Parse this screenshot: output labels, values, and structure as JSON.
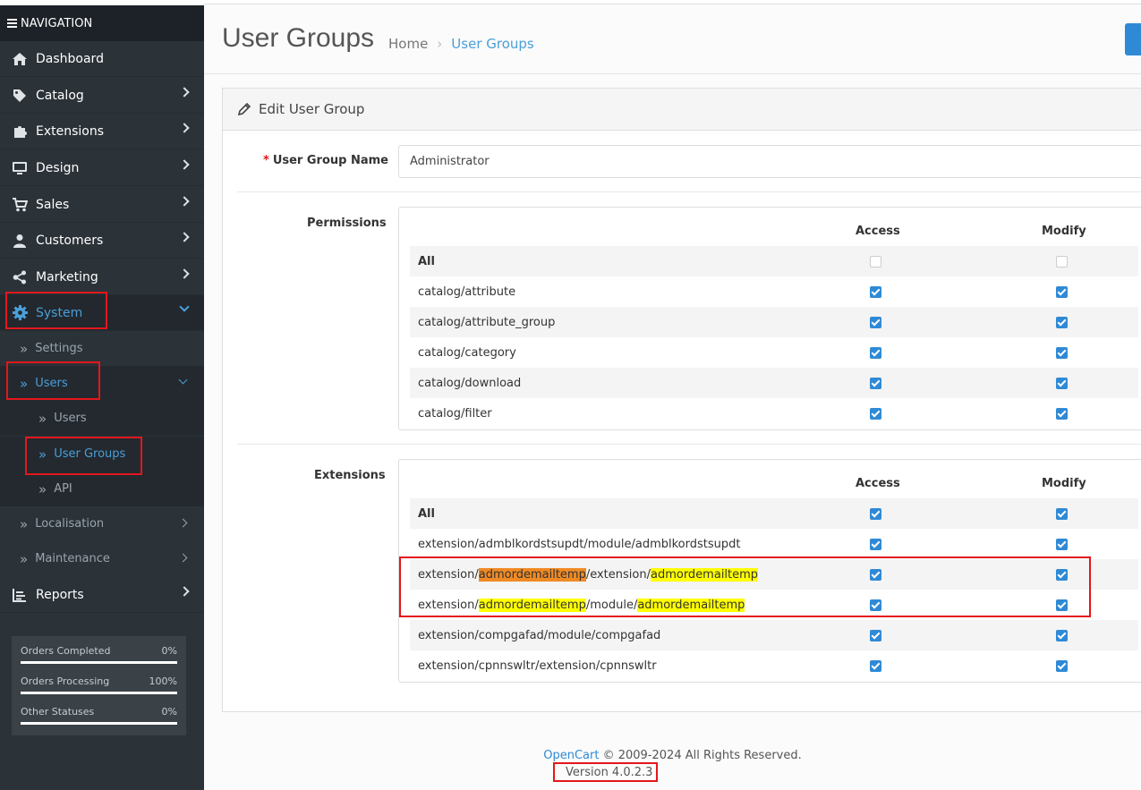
{
  "sidebar": {
    "header": "NAVIGATION",
    "items": [
      {
        "label": "Dashboard",
        "icon": "home-icon"
      },
      {
        "label": "Catalog",
        "icon": "tag-icon"
      },
      {
        "label": "Extensions",
        "icon": "puzzle-icon"
      },
      {
        "label": "Design",
        "icon": "monitor-icon"
      },
      {
        "label": "Sales",
        "icon": "cart-icon"
      },
      {
        "label": "Customers",
        "icon": "user-icon"
      },
      {
        "label": "Marketing",
        "icon": "share-icon"
      },
      {
        "label": "System",
        "icon": "gear-icon"
      },
      {
        "label": "Reports",
        "icon": "chart-icon"
      }
    ],
    "system_sub": {
      "settings": "Settings",
      "users": "Users",
      "users_sub": [
        "Users",
        "User Groups",
        "API"
      ],
      "localisation": "Localisation",
      "maintenance": "Maintenance"
    },
    "stats": [
      {
        "label": "Orders Completed",
        "pct": "0%",
        "value": 0
      },
      {
        "label": "Orders Processing",
        "pct": "100%",
        "value": 1
      },
      {
        "label": "Other Statuses",
        "pct": "0%",
        "value": 0
      }
    ]
  },
  "header": {
    "title": "User Groups",
    "breadcrumb": [
      "Home",
      "User Groups"
    ]
  },
  "card": {
    "title": "Edit User Group",
    "name_label": "User Group Name",
    "name_required_mark": "*",
    "name_value": "Administrator",
    "permissions_label": "Permissions",
    "extensions_label": "Extensions",
    "col_access": "Access",
    "col_modify": "Modify",
    "permissions": [
      {
        "label": "All",
        "access": false,
        "modify": false
      },
      {
        "label": "catalog/attribute",
        "access": true,
        "modify": true
      },
      {
        "label": "catalog/attribute_group",
        "access": true,
        "modify": true
      },
      {
        "label": "catalog/category",
        "access": true,
        "modify": true
      },
      {
        "label": "catalog/download",
        "access": true,
        "modify": true
      },
      {
        "label": "catalog/filter",
        "access": true,
        "modify": true
      }
    ],
    "extensions": [
      {
        "label": "All",
        "access": true,
        "modify": true
      },
      {
        "label": "extension/admblkordstsupdt/module/admblkordstsupdt",
        "access": true,
        "modify": true
      },
      {
        "label": "extension/admordemailtemp/extension/admordemailtemp",
        "access": true,
        "modify": true
      },
      {
        "label": "extension/admordemailtemp/module/admordemailtemp",
        "access": true,
        "modify": true
      },
      {
        "label": "extension/compgafad/module/compgafad",
        "access": true,
        "modify": true
      },
      {
        "label": "extension/cpnnswltr/extension/cpnnswltr",
        "access": true,
        "modify": true
      }
    ],
    "ext_parts": {
      "p1": "extension/",
      "h1": "admordemailtemp",
      "p2": "/extension/",
      "h2": "admordemailtemp",
      "p3": "extension/",
      "h3": "admordemailtemp",
      "p4": "/module/",
      "h4": "admordemailtemp"
    }
  },
  "footer": {
    "brand": "OpenCart",
    "copyright": "© 2009-2024 All Rights Reserved.",
    "version": "Version 4.0.2.3"
  },
  "colors": {
    "sidebar_bg": "#2b3238",
    "accent": "#2f8ad6",
    "annotation": "#e3171c",
    "highlight_orange": "#f08a24",
    "highlight_yellow": "#ffff00"
  }
}
